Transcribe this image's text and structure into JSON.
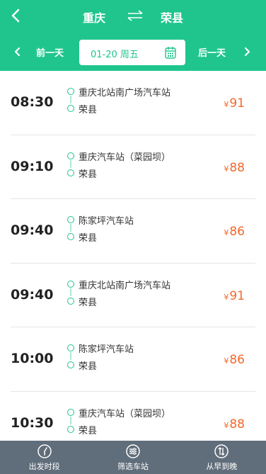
{
  "header": {
    "from_city": "重庆",
    "to_city": "荣县",
    "prev_day": "前一天",
    "next_day": "后一天",
    "date": "01-20 周五"
  },
  "trips": [
    {
      "time": "08:30",
      "from": "重庆北站南广场汽车站",
      "to": "荣县",
      "currency": "¥",
      "price": "91"
    },
    {
      "time": "09:10",
      "from": "重庆汽车站（菜园坝）",
      "to": "荣县",
      "currency": "¥",
      "price": "88"
    },
    {
      "time": "09:40",
      "from": "陈家坪汽车站",
      "to": "荣县",
      "currency": "¥",
      "price": "86"
    },
    {
      "time": "09:40",
      "from": "重庆北站南广场汽车站",
      "to": "荣县",
      "currency": "¥",
      "price": "91"
    },
    {
      "time": "10:00",
      "from": "陈家坪汽车站",
      "to": "荣县",
      "currency": "¥",
      "price": "86"
    },
    {
      "time": "10:30",
      "from": "重庆汽车站（菜园坝）",
      "to": "荣县",
      "currency": "¥",
      "price": "88"
    }
  ],
  "footer": {
    "items": [
      {
        "label": "出发时段",
        "icon": "clock-icon"
      },
      {
        "label": "筛选车站",
        "icon": "filter-icon"
      },
      {
        "label": "从早到晚",
        "icon": "sort-icon"
      }
    ]
  },
  "colors": {
    "primary": "#20c58e",
    "price": "#f2682b",
    "footer": "#606d7a"
  }
}
